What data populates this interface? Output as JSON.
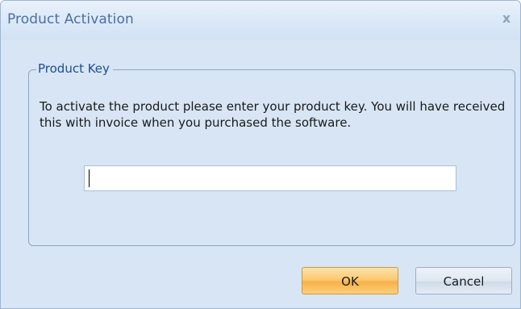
{
  "window": {
    "title": "Product Activation",
    "close_icon": "close-icon",
    "close_glyph": "x"
  },
  "groupbox": {
    "legend": "Product Key",
    "description": "To activate the product please enter your product key. You will have received this with invoice when you purchased the software."
  },
  "product_key_input": {
    "value": "",
    "placeholder": ""
  },
  "buttons": {
    "ok_label": "OK",
    "cancel_label": "Cancel"
  },
  "colors": {
    "window_bg": "#d7e5f4",
    "title_text": "#4a6fa5",
    "legend_text": "#1f4c96",
    "ok_button": "#fcc973",
    "cancel_button": "#dfe8f2"
  }
}
